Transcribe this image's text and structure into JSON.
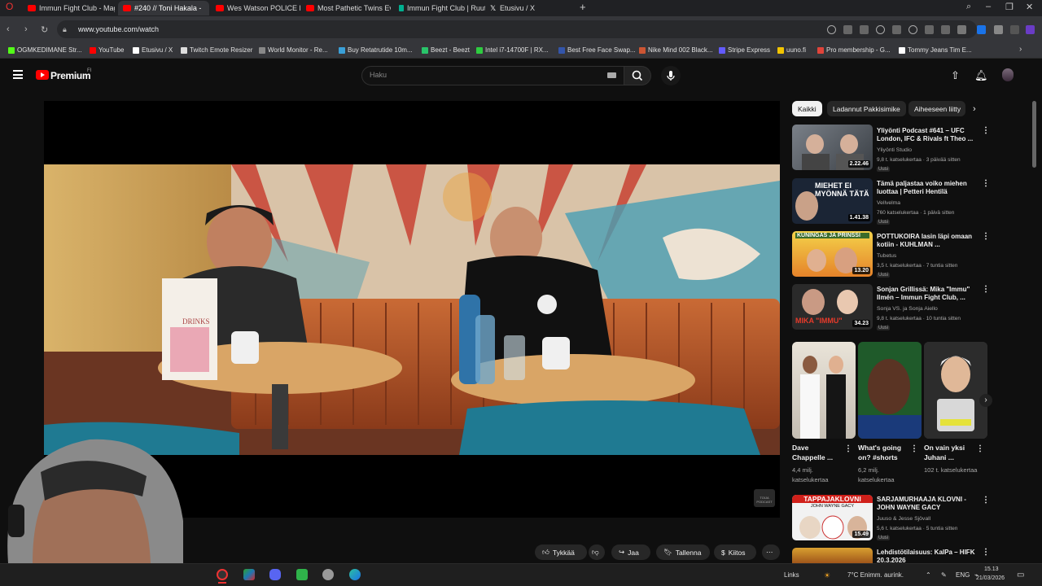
{
  "browser": {
    "tabs": [
      {
        "title": "Immun Fight Club - Mag",
        "icon": "youtube",
        "active": false
      },
      {
        "title": "#240 // Toni Hakala -",
        "icon": "youtube",
        "active": true
      },
      {
        "title": "Wes Watson POLICE REPO",
        "icon": "youtube",
        "active": false
      },
      {
        "title": "Most Pathetic Twins Ever",
        "icon": "youtube",
        "active": false
      },
      {
        "title": "Immun Fight Club | Ruutu",
        "icon": "ruutu",
        "active": false
      },
      {
        "title": "Etusivu / X",
        "icon": "x",
        "active": false
      }
    ],
    "new_tab": "+",
    "url": "www.youtube.com/watch",
    "bookmarks": [
      {
        "label": "OGMKEDIMANE Str...",
        "color": "#53fc18"
      },
      {
        "label": "YouTube",
        "color": "#ff0000"
      },
      {
        "label": "Etusivu / X",
        "color": "#ffffff"
      },
      {
        "label": "Twitch Emote Resizer",
        "color": "#dddddd"
      },
      {
        "label": "World Monitor - Re...",
        "color": "#888888"
      },
      {
        "label": "Buy Retatrutide 10m...",
        "color": "#3aa0d8"
      },
      {
        "label": "Beezt - Beezt",
        "color": "#29c46a"
      },
      {
        "label": "Intel i7-14700F | RX...",
        "color": "#2ecc40"
      },
      {
        "label": "Best Free Face Swap...",
        "color": "#3355aa"
      },
      {
        "label": "Nike Mind 002 Black...",
        "color": "#cc5533"
      },
      {
        "label": "Stripe Express",
        "color": "#635bff"
      },
      {
        "label": "uuno.fi",
        "color": "#f2c400"
      },
      {
        "label": "Pro membership - G...",
        "color": "#e0443a"
      },
      {
        "label": "Tommy Jeans Tim E...",
        "color": "#ffffff"
      }
    ]
  },
  "youtube": {
    "brand": "Premium",
    "brand_region": "FI",
    "search_placeholder": "Haku",
    "actions": {
      "like": "Tykkää",
      "share": "Jaa",
      "save": "Tallenna",
      "thanks": "Kiitos",
      "more": "⋯"
    },
    "chips": [
      "Kaikki",
      "Ladannut Pakkisimike",
      "Aiheeseen liitty"
    ],
    "videos": [
      {
        "title": "Yliyönti Podcast #641 – UFC London, IFC & Rivals ft Theo ...",
        "channel": "Yliyönti Studio",
        "meta": "9,8 t. katselukertaa · 3 päivää sitten",
        "badge": "Uusi",
        "duration": "2.22.46"
      },
      {
        "title": "Tämä paljastaa voiko miehen luottaa | Petteri Hentilä",
        "channel": "Vellvelma",
        "meta": "760 katselukertaa · 1 päivä sitten",
        "badge": "Uusi",
        "duration": "1.41.38"
      },
      {
        "title": "POTTUKOIRA lasin läpi omaan kotiin - KUHLMAN ...",
        "channel": "Tubetus",
        "meta": "3,5 t. katselukertaa · 7 tuntia sitten",
        "badge": "Uusi",
        "duration": "13.20"
      },
      {
        "title": "Sonjan Grillissä: Mika \"Immu\" Ilmén – Immun Fight Club, ...",
        "channel": "Sonja VS. ja Sonja Aiello",
        "meta": "9,8 t. katselukertaa · 10 tuntia sitten",
        "badge": "Uusi",
        "duration": "34.23"
      }
    ],
    "shorts": [
      {
        "title": "Dave Chappelle ...",
        "views": "4,4 milj. katselukertaa"
      },
      {
        "title": "What's going on? #shorts",
        "views": "6,2 milj. katselukertaa"
      },
      {
        "title": "On vain yksi Juhani ...",
        "views": "102 t. katselukertaa"
      }
    ],
    "videos_below": [
      {
        "title": "SARJAMURHAAJA KLOVNI - JOHN WAYNE GACY",
        "channel": "Juuso & Jesse Sjövall",
        "meta": "5,6 t. katselukertaa · 5 tuntia sitten",
        "badge": "Uusi",
        "duration": "15.49",
        "thumb_text": "TAPPAJAKLOVNI",
        "thumb_sub": "JOHN WAYNE GACY"
      },
      {
        "title": "Lehdistötilaisuus: KalPa – HIFK 20.3.2026",
        "channel": "",
        "meta": "",
        "badge": "",
        "duration": "",
        "thumb_text": "",
        "thumb_sub": ""
      }
    ],
    "thumb_texts": {
      "v2": "MIEHET EI MYÖNNÄ TÄTÄ",
      "v3": "KUNINGAS JA PRINSSI",
      "v4": "MIKA \"IMMU\""
    },
    "drinks_menu": "DRINKS",
    "corner_logo": "TOIJA PODCAST"
  },
  "taskbar": {
    "links": "Links",
    "weather": "7°C  Enimm. aurink.",
    "lang": "ENG",
    "time": "15.13",
    "date": "21/03/2026"
  },
  "colors": {
    "background": "#0f0f0f",
    "youtube_red": "#ff0000",
    "chip_bg": "#272727"
  }
}
